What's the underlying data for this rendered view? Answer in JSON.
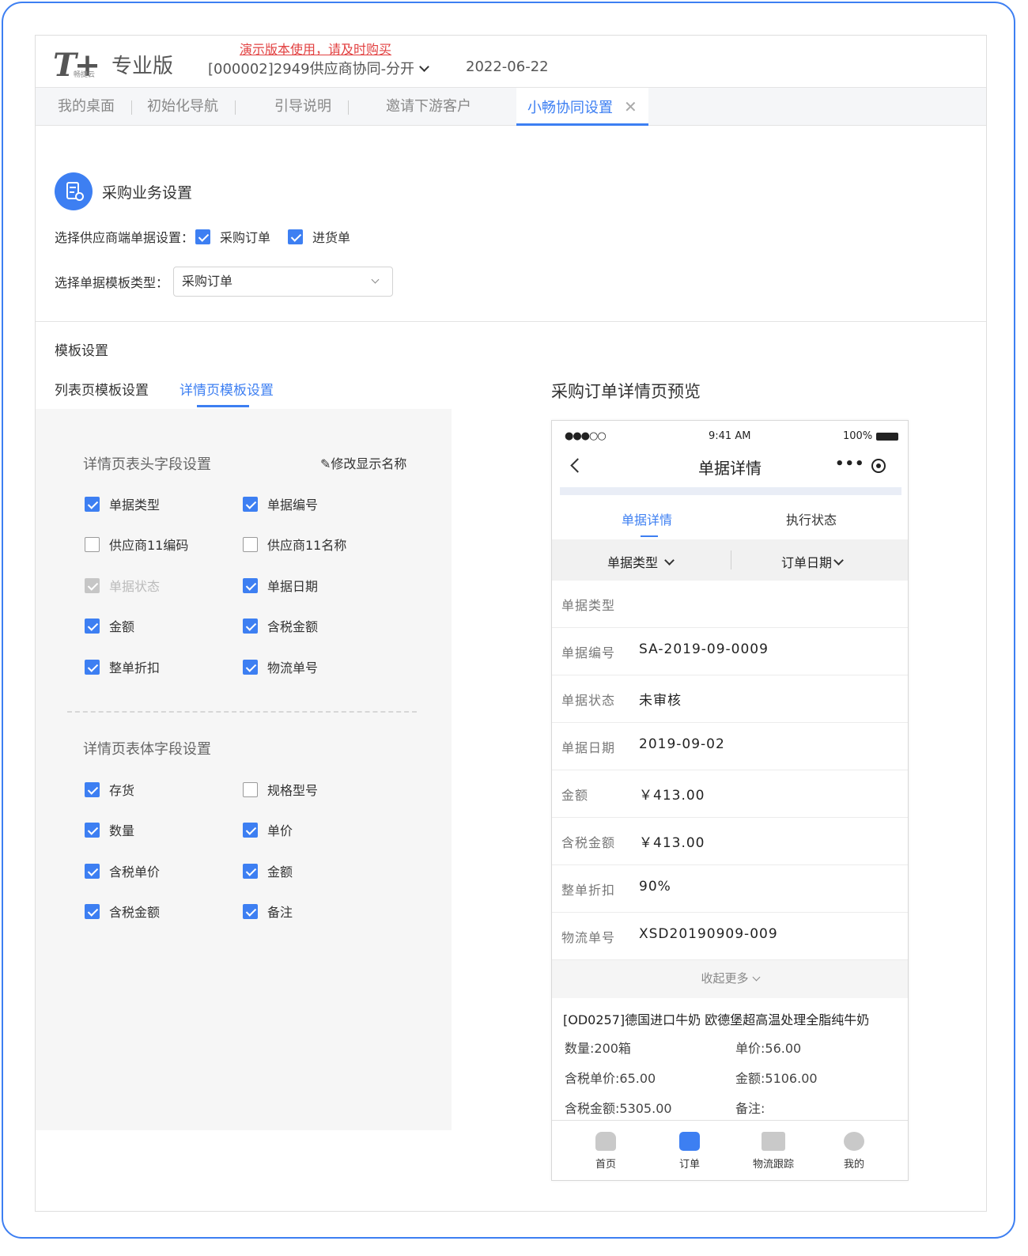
{
  "header": {
    "logo": "T+",
    "logo_sub": "畅捷云",
    "edition": "专业版",
    "demo_notice": "演示版本使用，请及时购买",
    "company": "[000002]2949供应商协同-分开",
    "date": "2022-06-22"
  },
  "tabs": [
    {
      "label": "我的桌面"
    },
    {
      "label": "初始化导航"
    },
    {
      "label": "引导说明"
    },
    {
      "label": "邀请下游客户"
    },
    {
      "label": "小畅协同设置",
      "close": "✕"
    }
  ],
  "section": {
    "title": "采购业务设置",
    "supplier_doc_label": "选择供应商端单据设置：",
    "doc_options": [
      {
        "label": "采购订单",
        "checked": true
      },
      {
        "label": "进货单",
        "checked": true
      }
    ],
    "template_type_label": "选择单据模板类型：",
    "template_type_value": "采购订单"
  },
  "template": {
    "title": "模板设置",
    "subtabs": [
      "列表页模板设置",
      "详情页模板设置"
    ],
    "header_fields_title": "详情页表头字段设置",
    "edit_label": "修改显示名称",
    "header_fields": [
      {
        "label": "单据类型",
        "state": "on"
      },
      {
        "label": "单据编号",
        "state": "on"
      },
      {
        "label": "供应商11编码",
        "state": "off"
      },
      {
        "label": "供应商11名称",
        "state": "off"
      },
      {
        "label": "单据状态",
        "state": "disabled"
      },
      {
        "label": "单据日期",
        "state": "on"
      },
      {
        "label": "金额",
        "state": "on"
      },
      {
        "label": "含税金额",
        "state": "on"
      },
      {
        "label": "整单折扣",
        "state": "on"
      },
      {
        "label": "物流单号",
        "state": "on"
      }
    ],
    "body_fields_title": "详情页表体字段设置",
    "body_fields": [
      {
        "label": "存货",
        "state": "on"
      },
      {
        "label": "规格型号",
        "state": "off"
      },
      {
        "label": "数量",
        "state": "on"
      },
      {
        "label": "单价",
        "state": "on"
      },
      {
        "label": "含税单价",
        "state": "on"
      },
      {
        "label": "金额",
        "state": "on"
      },
      {
        "label": "含税金额",
        "state": "on"
      },
      {
        "label": "备注",
        "state": "on"
      }
    ]
  },
  "preview": {
    "title": "采购订单详情页预览",
    "status": {
      "signal": "●●●○○",
      "time": "9:41 AM",
      "battery": "100%"
    },
    "nav_title": "单据详情",
    "capsule_dots": "•••",
    "tabs": [
      "单据详情",
      "执行状态"
    ],
    "filters": [
      "单据类型",
      "订单日期"
    ],
    "rows": [
      {
        "k": "单据类型",
        "v": ""
      },
      {
        "k": "单据编号",
        "v": "SA-2019-09-0009"
      },
      {
        "k": "单据状态",
        "v": "未审核"
      },
      {
        "k": "单据日期",
        "v": "2019-09-02"
      },
      {
        "k": "金额",
        "v": "￥413.00"
      },
      {
        "k": "含税金额",
        "v": "￥413.00"
      },
      {
        "k": "整单折扣",
        "v": "90%"
      },
      {
        "k": "物流单号",
        "v": "XSD20190909-009"
      }
    ],
    "more": "收起更多",
    "goods_name": "[OD0257]德国进口牛奶 欧德堡超高温处理全脂纯牛奶",
    "goods": {
      "qty": "数量:200箱",
      "price": "单价:56.00",
      "tax_price": "含税单价:65.00",
      "amount": "金额:5106.00",
      "tax_amount": "含税金额:5305.00",
      "note": "备注:"
    },
    "tabbar": [
      "首页",
      "订单",
      "物流跟踪",
      "我的"
    ]
  }
}
